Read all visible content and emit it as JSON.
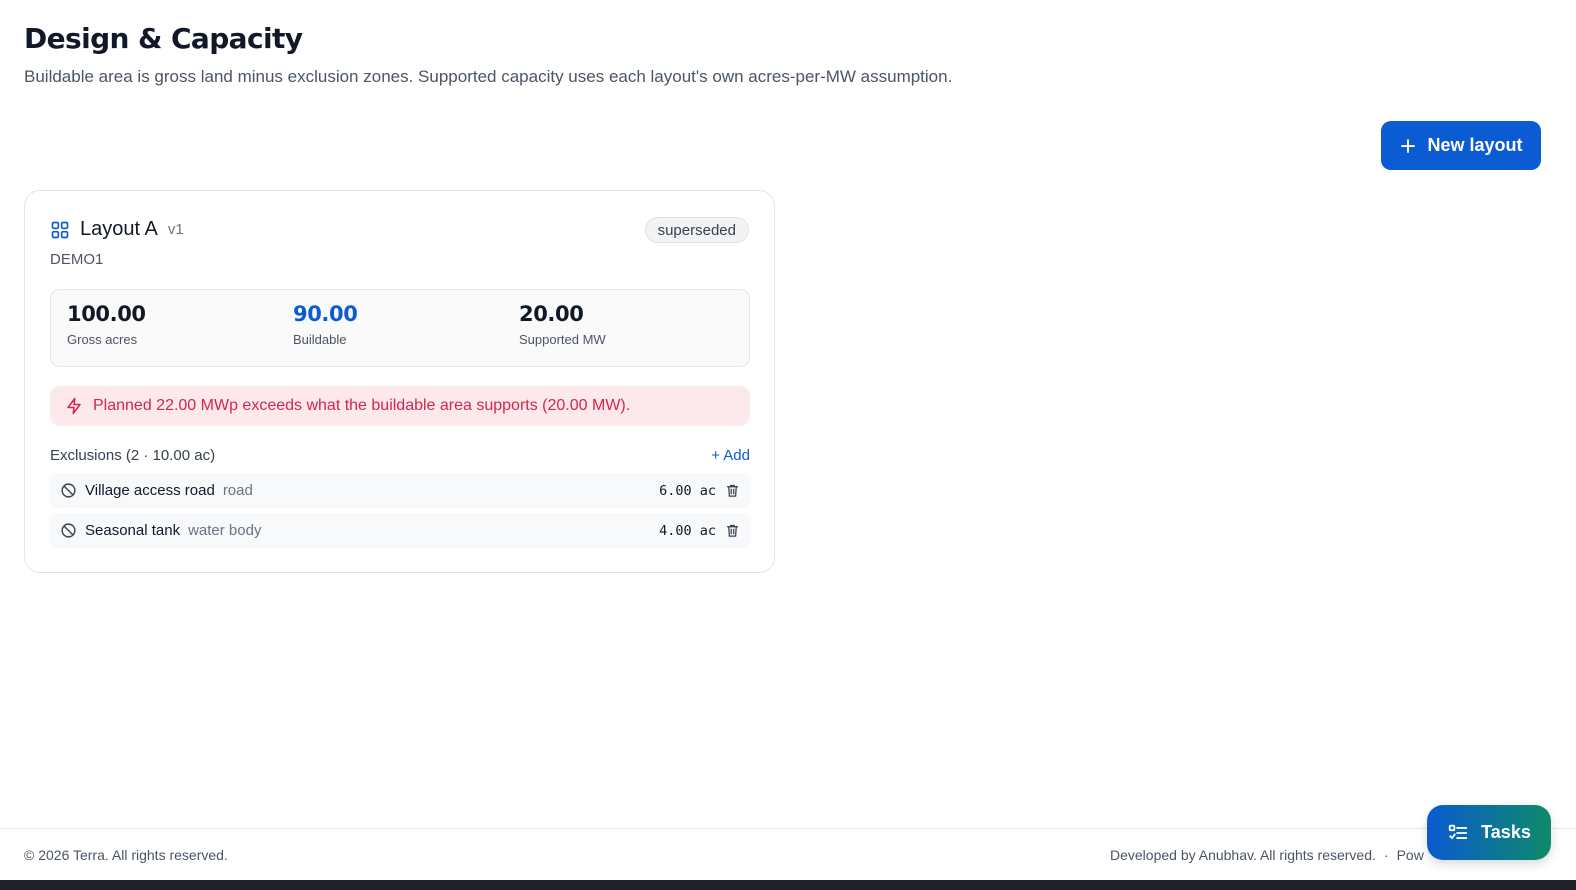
{
  "page": {
    "title": "Design & Capacity",
    "subtitle": "Buildable area is gross land minus exclusion zones. Supported capacity uses each layout's own acres-per-MW assumption.",
    "new_layout_label": "New layout"
  },
  "layout": {
    "name": "Layout A",
    "version": "v1",
    "code": "DEMO1",
    "status": "superseded",
    "metrics": [
      {
        "value": "100.00",
        "label": "Gross acres"
      },
      {
        "value": "90.00",
        "label": "Buildable",
        "accent": "#0b5bd3"
      },
      {
        "value": "20.00",
        "label": "Supported MW"
      }
    ],
    "warning": "Planned 22.00 MWp exceeds what the buildable area supports (20.00 MW).",
    "exclusions_title": "Exclusions (2 · 10.00 ac)",
    "add_label": "+ Add",
    "exclusions": [
      {
        "name": "Village access road",
        "type": "road",
        "area": "6.00 ac"
      },
      {
        "name": "Seasonal tank",
        "type": "water body",
        "area": "4.00 ac"
      }
    ]
  },
  "footer": {
    "copyright": "© 2026 Terra. All rights reserved.",
    "credit": "Developed by Anubhav. All rights reserved.",
    "separator": "·",
    "powered_partial": "Pow"
  },
  "tasks": {
    "label": "Tasks"
  },
  "colors": {
    "primary": "#0b5bd3",
    "warning_text": "#d4264d",
    "warning_bg": "#fde8ec",
    "tasks_gradient_end": "#0f8a6a"
  },
  "icons": {
    "new_layout": "plus-icon",
    "layout": "grid-icon",
    "warning": "lightning-icon",
    "exclusion": "ban-icon",
    "delete": "trash-icon",
    "tasks": "checklist-icon"
  }
}
